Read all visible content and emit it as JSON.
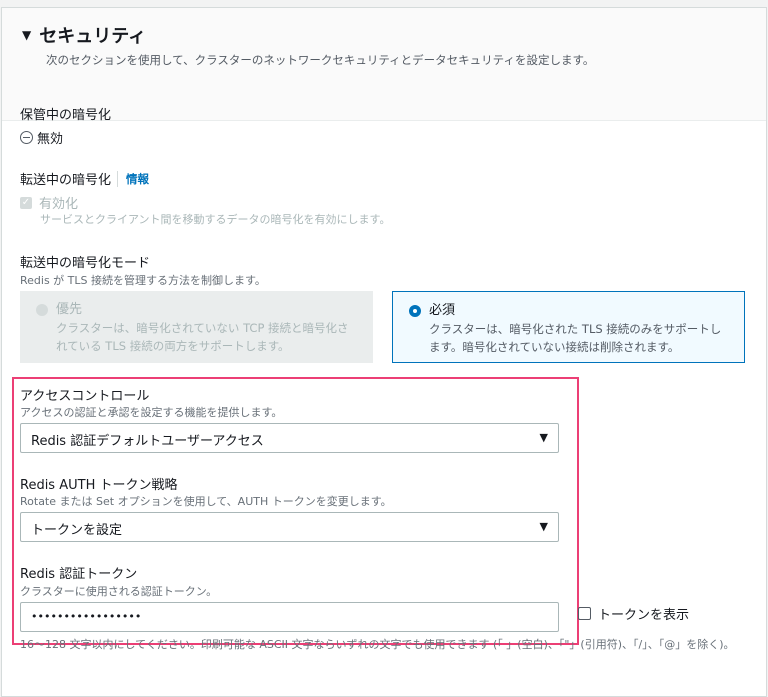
{
  "section": {
    "title": "セキュリティ",
    "description": "次のセクションを使用して、クラスターのネットワークセキュリティとデータセキュリティを設定します。"
  },
  "at_rest": {
    "label": "保管中の暗号化",
    "value": "無効"
  },
  "in_transit": {
    "label": "転送中の暗号化",
    "info": "情報",
    "checkbox_label": "有効化",
    "checkbox_desc": "サービスとクライアント間を移動するデータの暗号化を有効にします。",
    "checked": true
  },
  "mode": {
    "label": "転送中の暗号化モード",
    "desc": "Redis が TLS 接続を管理する方法を制御します。",
    "options": [
      {
        "title": "優先",
        "desc": "クラスターは、暗号化されていない TCP 接続と暗号化されている TLS 接続の両方をサポートします。",
        "selected": false,
        "disabled": true
      },
      {
        "title": "必須",
        "desc": "クラスターは、暗号化された TLS 接続のみをサポートします。暗号化されていない接続は削除されます。",
        "selected": true
      }
    ]
  },
  "access": {
    "label": "アクセスコントロール",
    "desc": "アクセスの認証と承認を設定する機能を提供します。",
    "value": "Redis 認証デフォルトユーザーアクセス"
  },
  "strategy": {
    "label": "Redis AUTH トークン戦略",
    "desc": "Rotate または Set オプションを使用して、AUTH トークンを変更します。",
    "value": "トークンを設定"
  },
  "token": {
    "label": "Redis 認証トークン",
    "desc": "クラスターに使用される認証トークン。",
    "value": "•••••••••••••••••",
    "show_label": "トークンを表示",
    "constraint": "16～128 文字以内にしてください。印刷可能な ASCII 文字ならいずれの文字でも使用できます (「 」(空白)、「\"」(引用符)、「/」、「@」を除く)。"
  },
  "colors": {
    "highlight": "#ec3f75",
    "link": "#0073bb"
  }
}
